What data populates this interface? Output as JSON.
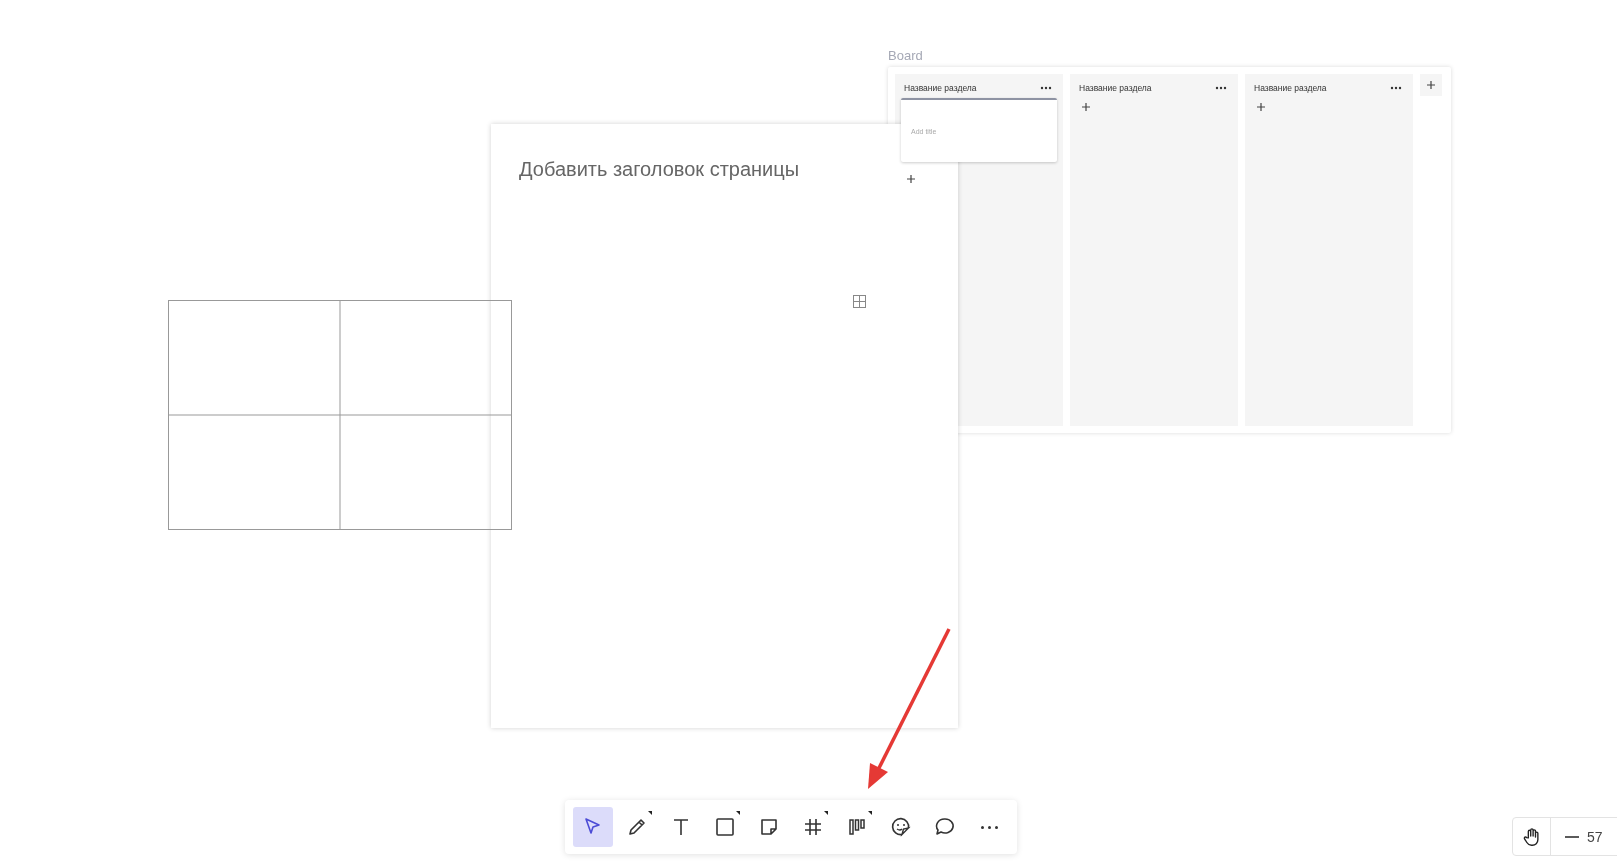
{
  "board": {
    "label": "Board",
    "columns": [
      {
        "title": "Название раздела",
        "cards": [
          {
            "placeholder": "Add title"
          }
        ]
      },
      {
        "title": "Название раздела"
      },
      {
        "title": "Название раздела"
      }
    ]
  },
  "page": {
    "title_placeholder": "Добавить заголовок страницы"
  },
  "toolbar": {
    "tools": [
      {
        "kind": "select",
        "selected": true,
        "submenu": false
      },
      {
        "kind": "pen",
        "selected": false,
        "submenu": true
      },
      {
        "kind": "text",
        "selected": false,
        "submenu": false
      },
      {
        "kind": "shape",
        "selected": false,
        "submenu": true
      },
      {
        "kind": "sticky",
        "selected": false,
        "submenu": false
      },
      {
        "kind": "frame",
        "selected": false,
        "submenu": true
      },
      {
        "kind": "board",
        "selected": false,
        "submenu": true
      },
      {
        "kind": "sticker",
        "selected": false,
        "submenu": false
      },
      {
        "kind": "comment",
        "selected": false,
        "submenu": false
      },
      {
        "kind": "more",
        "selected": false,
        "submenu": false
      }
    ]
  },
  "zoom": {
    "value": "57"
  }
}
